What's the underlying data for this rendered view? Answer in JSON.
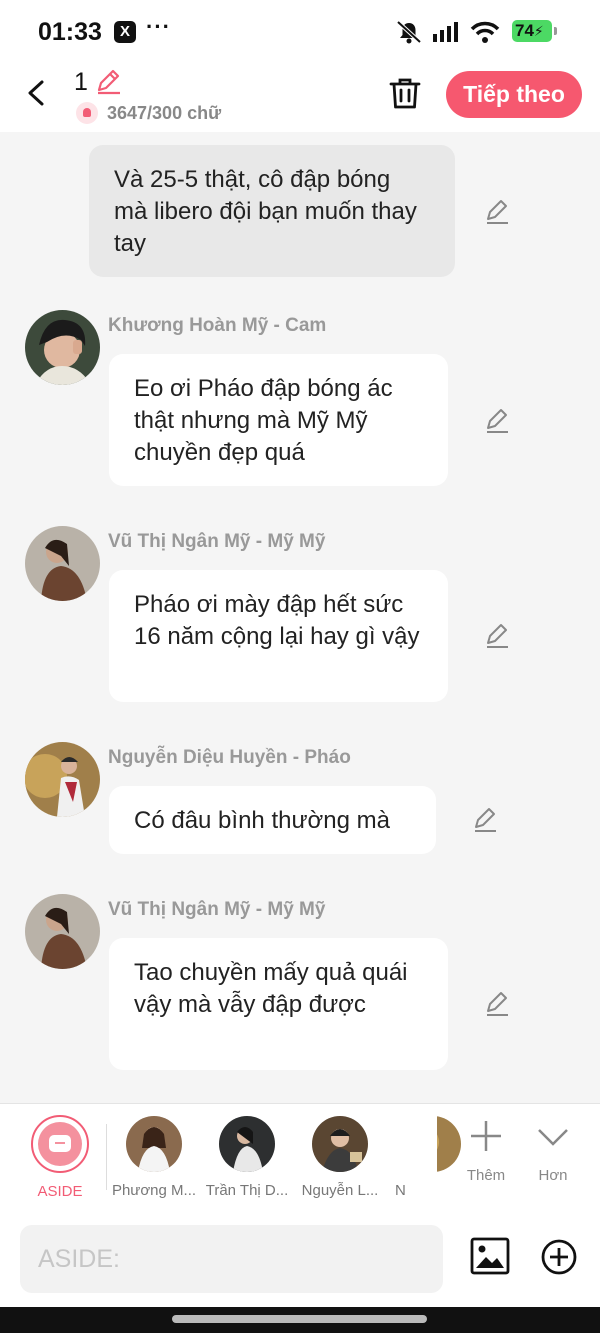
{
  "status_bar": {
    "time": "01:33",
    "x_badge": "X",
    "more": "···",
    "battery": "74"
  },
  "header": {
    "chapter_number": "1",
    "word_count": "3647/300 chữ",
    "next_button": "Tiếp theo"
  },
  "messages": [
    {
      "type": "narration",
      "text": "Và 25-5 thật, cô đập bóng mà libero đội bạn muốn thay tay"
    },
    {
      "type": "chat",
      "sender": "Khương Hoàn Mỹ - Cam",
      "text": "Eo ơi Pháo đập bóng ác thật nhưng mà Mỹ Mỹ chuyền đẹp quá"
    },
    {
      "type": "chat",
      "sender": "Vũ Thị Ngân Mỹ - Mỹ Mỹ",
      "text": "Pháo ơi mày đập hết sức 16 năm cộng lại hay gì vậy"
    },
    {
      "type": "chat",
      "sender": "Nguyễn Diệu Huyền - Pháo",
      "text": "Có đâu bình thường mà"
    },
    {
      "type": "chat",
      "sender": "Vũ Thị Ngân Mỹ - Mỹ Mỹ",
      "text": "Tao chuyền mấy quả quái vậy mà vẫy đập được"
    }
  ],
  "character_bar": {
    "aside_label": "ASIDE",
    "characters": [
      {
        "name": "Phương M..."
      },
      {
        "name": "Trần Thị D..."
      },
      {
        "name": "Nguyễn L..."
      },
      {
        "name": "Nguyễ"
      }
    ],
    "add_label": "Thêm",
    "more_label": "Hơn"
  },
  "input": {
    "placeholder": "ASIDE:"
  },
  "colors": {
    "accent": "#f6586f",
    "narration_bg": "#e8e8e8",
    "chat_bg": "#ffffff"
  },
  "icons": [
    "back-arrow-icon",
    "pencil-icon",
    "trash-icon",
    "image-icon",
    "add-circle-icon",
    "plus-icon",
    "chevron-down-icon"
  ]
}
